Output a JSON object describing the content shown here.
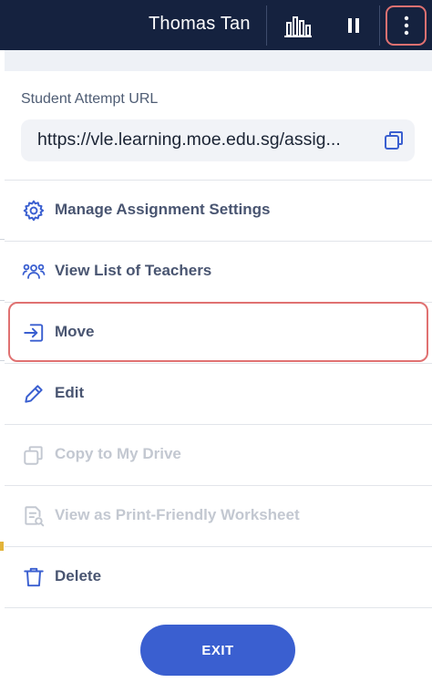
{
  "header": {
    "user_name": "Thomas Tan",
    "icons": [
      "bar-chart-icon",
      "pause-icon",
      "more-vertical-icon"
    ]
  },
  "url_section": {
    "label": "Student Attempt URL",
    "url": "https://vle.learning.moe.edu.sg/assig...",
    "copy_icon": "copy-icon"
  },
  "menu": {
    "items": [
      {
        "label": "Manage Assignment Settings",
        "icon": "gear-icon",
        "enabled": true
      },
      {
        "label": "View List of Teachers",
        "icon": "users-icon",
        "enabled": true
      },
      {
        "label": "Move",
        "icon": "move-icon",
        "enabled": true,
        "highlighted": true
      },
      {
        "label": "Edit",
        "icon": "pencil-icon",
        "enabled": true
      },
      {
        "label": "Copy to My Drive",
        "icon": "copy-icon",
        "enabled": false
      },
      {
        "label": "View as Print-Friendly Worksheet",
        "icon": "document-search-icon",
        "enabled": false
      },
      {
        "label": "Delete",
        "icon": "trash-icon",
        "enabled": true
      }
    ]
  },
  "exit_button": {
    "label": "EXIT"
  },
  "colors": {
    "header_bg": "#15223f",
    "accent_blue": "#3a5fd0",
    "highlight_red": "#e07171",
    "text_enabled": "#495571",
    "text_disabled": "#c3c8d1"
  }
}
